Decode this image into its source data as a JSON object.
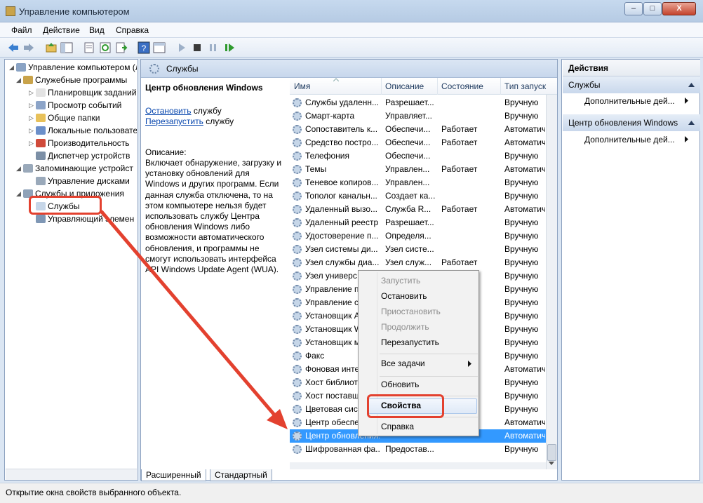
{
  "window": {
    "title": "Управление компьютером",
    "controls": [
      "–",
      "□",
      "X"
    ]
  },
  "menu": [
    "Файл",
    "Действие",
    "Вид",
    "Справка"
  ],
  "toolbar_icons": [
    "back-arrow-icon",
    "forward-arrow-icon",
    "up-folder-icon",
    "show-hide-tree-icon",
    "export-icon",
    "refresh-icon",
    "export-list-icon",
    "help-icon",
    "properties-view-icon",
    "play-icon",
    "stop-icon",
    "pause-icon",
    "restart-icon"
  ],
  "tree": [
    {
      "label": "Управление компьютером (л",
      "level": 0,
      "icon": "computer-icon"
    },
    {
      "label": "Служебные программы",
      "level": 1,
      "icon": "tools-icon"
    },
    {
      "label": "Планировщик заданий",
      "level": 2,
      "icon": "clock-icon"
    },
    {
      "label": "Просмотр событий",
      "level": 2,
      "icon": "event-viewer-icon"
    },
    {
      "label": "Общие папки",
      "level": 2,
      "icon": "shared-folder-icon"
    },
    {
      "label": "Локальные пользовате",
      "level": 2,
      "icon": "users-icon"
    },
    {
      "label": "Производительность",
      "level": 2,
      "icon": "performance-icon"
    },
    {
      "label": "Диспетчер устройств",
      "level": 2,
      "icon": "device-manager-icon"
    },
    {
      "label": "Запоминающие устройст",
      "level": 1,
      "icon": "storage-icon"
    },
    {
      "label": "Управление дисками",
      "level": 2,
      "icon": "disk-icon"
    },
    {
      "label": "Службы и приложения",
      "level": 1,
      "icon": "services-apps-icon"
    },
    {
      "label": "Службы",
      "level": 2,
      "icon": "gear-icon"
    },
    {
      "label": "Управляющий элемен",
      "level": 2,
      "icon": "wmi-icon"
    }
  ],
  "services_header": "Службы",
  "detail": {
    "title": "Центр обновления Windows",
    "stop_link": "Остановить",
    "stop_rest": " службу",
    "restart_link": "Перезапустить",
    "restart_rest": " службу",
    "desc_label": "Описание:",
    "desc_lines": [
      "Включает обнаружение, загрузку и",
      "установку обновлений для",
      "Windows и других программ. Если",
      "данная служба отключена, то на",
      "этом компьютере нельзя будет",
      "использовать службу Центра",
      "обновления Windows либо",
      "возможности автоматического",
      "обновления, и программы не",
      "смогут использовать интерфейса",
      "API Windows Update Agent (WUA)."
    ]
  },
  "columns": [
    "Имя",
    "Описание",
    "Состояние",
    "Тип запуск"
  ],
  "rows": [
    [
      "Службы удаленн...",
      "Разрешает...",
      "",
      "Вручную"
    ],
    [
      "Смарт-карта",
      "Управляет...",
      "",
      "Вручную"
    ],
    [
      "Сопоставитель к...",
      "Обеспечи...",
      "Работает",
      "Автоматич"
    ],
    [
      "Средство постро...",
      "Обеспечи...",
      "Работает",
      "Автоматич"
    ],
    [
      "Телефония",
      "Обеспечи...",
      "",
      "Вручную"
    ],
    [
      "Темы",
      "Управлен...",
      "Работает",
      "Автоматич"
    ],
    [
      "Теневое копиров...",
      "Управлен...",
      "",
      "Вручную"
    ],
    [
      "Тополог канальн...",
      "Создает ка...",
      "",
      "Вручную"
    ],
    [
      "Удаленный вызо...",
      "Служба R...",
      "Работает",
      "Автоматич"
    ],
    [
      "Удаленный реестр",
      "Разрешает...",
      "",
      "Вручную"
    ],
    [
      "Удостоверение п...",
      "Определя...",
      "",
      "Вручную"
    ],
    [
      "Узел системы ди...",
      "Узел систе...",
      "",
      "Вручную"
    ],
    [
      "Узел службы диа...",
      "Узел служ...",
      "Работает",
      "Вручную"
    ],
    [
      "Узел универс",
      "",
      "",
      "Вручную"
    ],
    [
      "Управление п",
      "",
      "",
      "Вручную"
    ],
    [
      "Управление с",
      "",
      "",
      "Вручную"
    ],
    [
      "Установщик A",
      "",
      "",
      "Вручную"
    ],
    [
      "Установщик W",
      "",
      "",
      "Вручную"
    ],
    [
      "Установщик м",
      "",
      "",
      "Вручную"
    ],
    [
      "Факс",
      "",
      "",
      "Вручную"
    ],
    [
      "Фоновая инте",
      "",
      "",
      "Автоматич"
    ],
    [
      "Хост библиот",
      "",
      "",
      "Вручную"
    ],
    [
      "Хост поставщ",
      "",
      "",
      "Вручную"
    ],
    [
      "Цветовая сис",
      "",
      "",
      "Вручную"
    ],
    [
      "Центр обеспе",
      "",
      "",
      "Автоматич"
    ],
    [
      "Центр обновления...",
      "",
      "",
      "Автоматич"
    ],
    [
      "Шифрованная фа...",
      "Предостав...",
      "",
      "Вручную"
    ]
  ],
  "selected_row": 25,
  "context_menu": [
    {
      "label": "Запустить",
      "disabled": true
    },
    {
      "label": "Остановить",
      "disabled": false
    },
    {
      "label": "Приостановить",
      "disabled": true
    },
    {
      "label": "Продолжить",
      "disabled": true
    },
    {
      "label": "Перезапустить",
      "disabled": false
    },
    {
      "label": "Все задачи",
      "disabled": false,
      "submenu": true
    },
    {
      "label": "Обновить",
      "disabled": false
    },
    {
      "label": "Свойства",
      "disabled": false,
      "bold": true
    },
    {
      "label": "Справка",
      "disabled": false
    }
  ],
  "tabs": [
    "Расширенный",
    "Стандартный"
  ],
  "actions": {
    "title": "Действия",
    "group1": "Службы",
    "group1_item": "Дополнительные дей...",
    "group2": "Центр обновления Windows",
    "group2_item": "Дополнительные дей..."
  },
  "status": "Открытие окна свойств выбранного объекта.",
  "colors": {
    "selection": "#3399ff",
    "annotation": "#e3412f",
    "link": "#0645ad"
  }
}
